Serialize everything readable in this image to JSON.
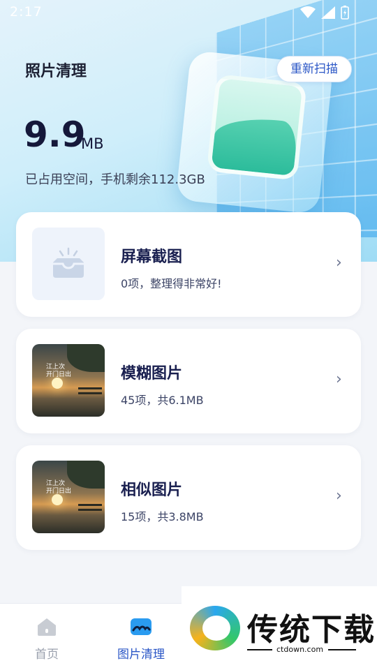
{
  "status_bar": {
    "time": "2:17"
  },
  "header": {
    "title": "照片清理",
    "rescan_label": "重新扫描",
    "size_value": "9.9",
    "size_unit": "MB",
    "space_info": "已占用空间，手机剩余112.3GB"
  },
  "cards": [
    {
      "title": "屏幕截图",
      "subtitle": "0项，整理得非常好!"
    },
    {
      "title": "模糊图片",
      "subtitle": "45项，共6.1MB",
      "photo_text": "江上次\n开门日出"
    },
    {
      "title": "相似图片",
      "subtitle": "15项，共3.8MB",
      "photo_text": "江上次\n开门日出"
    }
  ],
  "nav": {
    "items": [
      {
        "label": "首页",
        "active": false
      },
      {
        "label": "图片清理",
        "active": true
      }
    ],
    "active_color": "#2a56c6",
    "inactive_color": "#9aa0ad"
  },
  "watermark": {
    "name": "传统下载",
    "url": "ctdown.com"
  },
  "chevron_glyph": "›"
}
